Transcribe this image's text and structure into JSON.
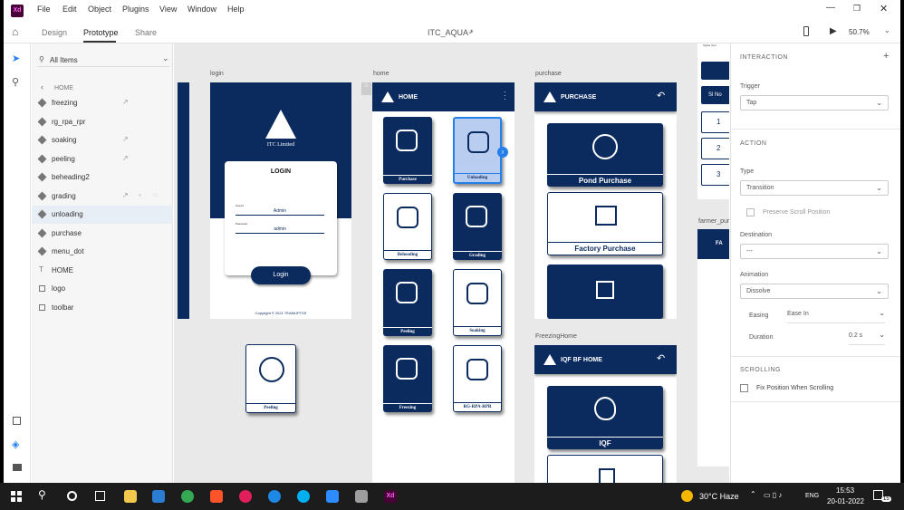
{
  "app": {
    "logo": "Xd",
    "doc_title": "ITC_AQUA *",
    "zoom": "50.7%"
  },
  "menu": [
    "File",
    "Edit",
    "Object",
    "Plugins",
    "View",
    "Window",
    "Help"
  ],
  "modes": [
    "Design",
    "Prototype",
    "Share"
  ],
  "layers": {
    "filter": "All Items",
    "breadcrumb": "HOME",
    "items": [
      {
        "label": "freezing",
        "icon": "component-icon"
      },
      {
        "label": "rg_rpa_rpr",
        "icon": "component-icon"
      },
      {
        "label": "soaking",
        "icon": "component-icon"
      },
      {
        "label": "peeling",
        "icon": "component-icon"
      },
      {
        "label": "beheading2",
        "icon": "component-icon"
      },
      {
        "label": "grading",
        "icon": "component-icon"
      },
      {
        "label": "unloading",
        "icon": "component-icon"
      },
      {
        "label": "purchase",
        "icon": "component-icon"
      },
      {
        "label": "menu_dot",
        "icon": "component-icon"
      },
      {
        "label": "HOME",
        "icon": "text-icon"
      },
      {
        "label": "logo",
        "icon": "image-icon"
      },
      {
        "label": "toolbar",
        "icon": "group-icon"
      }
    ]
  },
  "artboards": {
    "login": {
      "label": "login",
      "company": "ITC Limited",
      "title": "LOGIN",
      "user_label": "UserId",
      "user_value": "Admin",
      "pass_label": "Password",
      "pass_value": "admin",
      "button": "Login",
      "copyright": "Copyright © 2021 TEAMUPTSS"
    },
    "home": {
      "label": "home",
      "title": "HOME",
      "cards": [
        "Purchase",
        "Unloading",
        "Beheading",
        "Grading",
        "Peeling",
        "Soaking",
        "Freezing",
        "RG-RPA-RPR"
      ]
    },
    "purchase": {
      "label": "purchase",
      "title": "PURCHASE",
      "cards": [
        "Pond Purchase",
        "Factory Purchase"
      ]
    },
    "freezing": {
      "label": "FreezingHome",
      "title": "IQF BF HOME",
      "cards": [
        "IQF"
      ]
    },
    "farmer": {
      "label": "farmer_purc",
      "header": "FA",
      "slno": "Sl No",
      "rows": [
        "1",
        "2",
        "3"
      ],
      "tiny": "Vypse Xpo ..."
    },
    "peeling_standalone": "Peeling"
  },
  "props": {
    "interaction": "INTERACTION",
    "trigger_label": "Trigger",
    "trigger": "Tap",
    "action": "ACTION",
    "type_label": "Type",
    "type": "Transition",
    "preserve": "Preserve Scroll Position",
    "destination_label": "Destination",
    "destination": "---",
    "animation_label": "Animation",
    "animation": "Dissolve",
    "easing_label": "Easing",
    "easing": "Ease In",
    "duration_label": "Duration",
    "duration": "0.2 s",
    "scrolling": "SCROLLING",
    "fix": "Fix Position When Scrolling"
  },
  "taskbar": {
    "weather": "30°C Haze",
    "lang": "ENG",
    "time": "15:53",
    "date": "20-01-2022",
    "badge": "15"
  },
  "colors": {
    "navy": "#0b2b5e",
    "accent": "#2680eb"
  }
}
